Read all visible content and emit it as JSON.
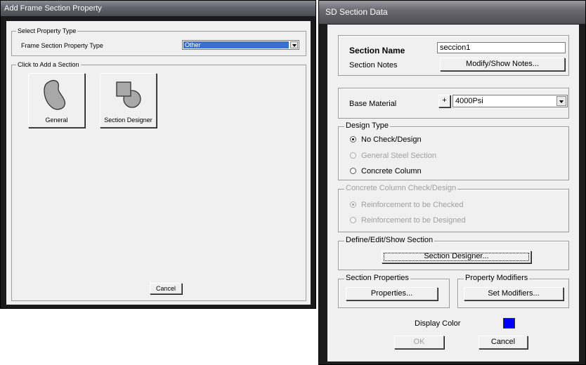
{
  "frame_dialog": {
    "title": "Add Frame Section Property",
    "select_group_title": "Select Property Type",
    "property_type_label": "Frame Section Property Type",
    "property_type_value": "Other",
    "add_group_title": "Click to Add a Section",
    "tiles": [
      {
        "label": "General",
        "icon": "general-shape-icon"
      },
      {
        "label": "Section Designer",
        "icon": "section-designer-icon"
      }
    ],
    "cancel_label": "Cancel"
  },
  "sd_dialog": {
    "title": "SD Section Data",
    "section_name_label": "Section Name",
    "section_name_value": "seccion1",
    "section_notes_label": "Section Notes",
    "modify_notes_button": "Modify/Show Notes...",
    "base_material_label": "Base Material",
    "plus_button": "+",
    "base_material_value": "4000Psi",
    "design_type_title": "Design Type",
    "design_type_options": [
      {
        "label": "No Check/Design",
        "selected": true,
        "enabled": true
      },
      {
        "label": "General Steel Section",
        "selected": false,
        "enabled": false
      },
      {
        "label": "Concrete Column",
        "selected": false,
        "enabled": true
      }
    ],
    "concrete_group_title": "Concrete Column Check/Design",
    "concrete_options": [
      {
        "label": "Reinforcement to be Checked",
        "selected": true,
        "enabled": false
      },
      {
        "label": "Reinforcement to be Designed",
        "selected": false,
        "enabled": false
      }
    ],
    "define_group_title": "Define/Edit/Show Section",
    "section_designer_button": "Section Designer...",
    "section_properties_title": "Section Properties",
    "properties_button": "Properties...",
    "property_modifiers_title": "Property Modifiers",
    "set_modifiers_button": "Set Modifiers...",
    "display_color_label": "Display Color",
    "display_color": "#0000ff",
    "ok_button": "OK",
    "cancel_button": "Cancel"
  }
}
